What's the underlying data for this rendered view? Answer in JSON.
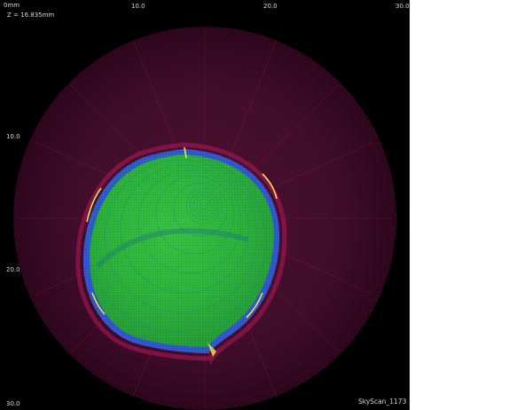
{
  "scan": {
    "z_readout": "Z = 16.835mm",
    "brand": "SkyScan_1173"
  },
  "ruler": {
    "top": [
      "0mm",
      "10.0",
      "20.0",
      "30.0"
    ],
    "left": [
      "10.0",
      "20.0",
      "30.0"
    ]
  },
  "colors": {
    "background": "#000000",
    "fov_circle": "#3a0d26",
    "sample_fill": "#2db83a",
    "sample_rim": "#2f4fd8",
    "sample_edge_highlight": "#f2e24a",
    "streak": "#c2184f"
  }
}
